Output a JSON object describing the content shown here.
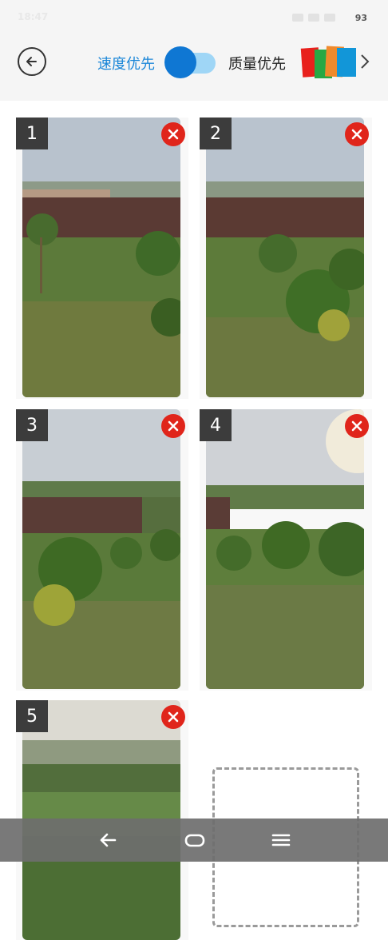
{
  "status": {
    "time": "18:47",
    "battery": "93"
  },
  "header": {
    "speed_label": "速度优先",
    "quality_label": "质量优先",
    "toggle_state": "speed"
  },
  "photos": [
    {
      "index": "1",
      "scene": "orchard-1"
    },
    {
      "index": "2",
      "scene": "orchard-2"
    },
    {
      "index": "3",
      "scene": "orchard-3"
    },
    {
      "index": "4",
      "scene": "orchard-4"
    },
    {
      "index": "5",
      "scene": "orchard-5"
    }
  ],
  "colors": {
    "accent": "#1a86d8",
    "toggle_knob": "#0f77d3",
    "toggle_track": "#9fd6f6",
    "delete_red": "#e0251b",
    "index_badge": "#3c3c3c"
  }
}
